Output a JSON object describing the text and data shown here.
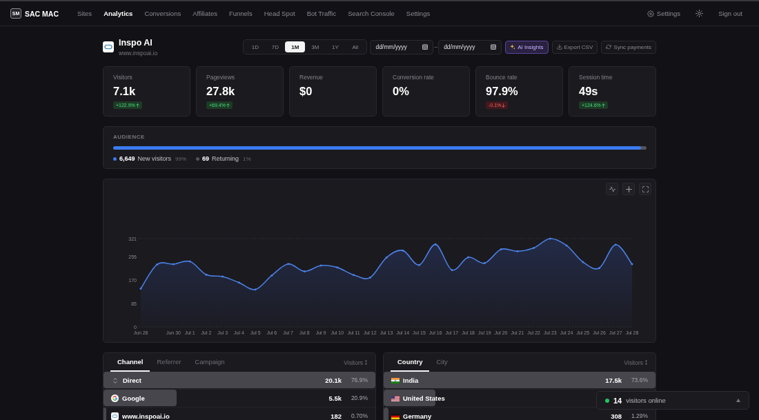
{
  "nav": {
    "logo": {
      "mark": "SM",
      "name": "SAC MAC"
    },
    "items": [
      {
        "label": "Sites",
        "selected": false
      },
      {
        "label": "Analytics",
        "selected": true
      },
      {
        "label": "Conversions",
        "selected": false
      },
      {
        "label": "Affiliates",
        "selected": false
      },
      {
        "label": "Funnels",
        "selected": false
      },
      {
        "label": "Head Spot",
        "selected": false
      },
      {
        "label": "Bot Traffic",
        "selected": false
      },
      {
        "label": "Search Console",
        "selected": false
      },
      {
        "label": "Settings",
        "selected": false
      }
    ],
    "settings_label": "Settings",
    "sign_out": "Sign out"
  },
  "site": {
    "name": "Inspo AI",
    "url": "www.inspoai.io"
  },
  "ranges": [
    {
      "label": "1D",
      "selected": false
    },
    {
      "label": "7D",
      "selected": false
    },
    {
      "label": "1M",
      "selected": true
    },
    {
      "label": "3M",
      "selected": false
    },
    {
      "label": "1Y",
      "selected": false
    },
    {
      "label": "All",
      "selected": false
    }
  ],
  "date_from": {
    "placeholder": "dd/mm/yyyy"
  },
  "date_separator": "–",
  "date_to": {
    "placeholder": "dd/mm/yyyy"
  },
  "actions": [
    {
      "kind": "ai",
      "label": "AI Insights"
    },
    {
      "kind": "export",
      "label": "Export CSV"
    },
    {
      "kind": "sync",
      "label": "Sync payments"
    }
  ],
  "stats": [
    {
      "label": "Visitors",
      "value": "7.1k",
      "delta": "+122.9%",
      "rising": true
    },
    {
      "label": "Pageviews",
      "value": "27.8k",
      "delta": "+69.4%",
      "rising": true
    },
    {
      "label": "Revenue",
      "value": "$0"
    },
    {
      "label": "Conversion rate",
      "value": "0%"
    },
    {
      "label": "Bounce rate",
      "value": "97.9%",
      "delta": "-0.1%",
      "rising": false
    },
    {
      "label": "Session time",
      "value": "49s",
      "delta": "+124.6%",
      "rising": true
    }
  ],
  "audience": {
    "title": "AUDIENCE",
    "level": 0.99,
    "segments": [
      {
        "count": "6,649",
        "label": "New visitors",
        "share": "99%",
        "color": "#3b7bf0"
      },
      {
        "count": "69",
        "label": "Returning",
        "share": "1%",
        "color": "#55545a"
      }
    ]
  },
  "chart": {
    "tools": [
      {
        "kind": "activity"
      },
      {
        "kind": "zoom"
      },
      {
        "kind": "fullscreen"
      }
    ],
    "chart_data": {
      "type": "area",
      "categories": [
        "Jun 28",
        null,
        "Jun 30",
        "Jul 1",
        "Jul 2",
        "Jul 3",
        "Jul 4",
        "Jul 5",
        "Jul 6",
        "Jul 7",
        "Jul 8",
        "Jul 9",
        "Jul 10",
        "Jul 11",
        "Jul 12",
        "Jul 13",
        "Jul 14",
        "Jul 15",
        "Jul 16",
        "Jul 17",
        "Jul 18",
        "Jul 19",
        "Jul 20",
        "Jul 21",
        "Jul 22",
        "Jul 23",
        "Jul 24",
        "Jul 25",
        "Jul 26",
        "Jul 27",
        "Jul 28"
      ],
      "values": [
        139,
        227,
        228,
        238,
        190,
        183,
        161,
        136,
        187,
        229,
        202,
        223,
        216,
        189,
        179,
        252,
        278,
        225,
        300,
        207,
        253,
        232,
        282,
        275,
        287,
        321,
        296,
        236,
        214,
        299,
        228
      ],
      "ylim": [
        0,
        321
      ],
      "yticks": [
        0,
        85,
        170,
        255,
        321
      ]
    }
  },
  "sources": {
    "tabs": [
      {
        "label": "Channel",
        "selected": true
      },
      {
        "label": "Referrer",
        "selected": false
      },
      {
        "label": "Campaign",
        "selected": false
      }
    ],
    "sort_label": "Visitors",
    "rows": [
      {
        "kind": "direct",
        "name": "Direct",
        "visitors": "20.1k",
        "share": "76.9%",
        "level": 1.0
      },
      {
        "kind": "google",
        "name": "Google",
        "visitors": "5.5k",
        "share": "20.9%",
        "level": 0.27
      },
      {
        "kind": "site",
        "name": "www.inspoai.io",
        "visitors": "182",
        "share": "0.70%",
        "level": 0.009
      }
    ]
  },
  "countries": {
    "tabs": [
      {
        "label": "Country",
        "selected": true
      },
      {
        "label": "City",
        "selected": false
      }
    ],
    "sort_label": "Visitors",
    "rows": [
      {
        "kind": "in",
        "name": "India",
        "visitors": "17.5k",
        "share": "73.6%",
        "level": 1.0
      },
      {
        "kind": "us",
        "name": "United States",
        "level": 0.19
      },
      {
        "kind": "de",
        "name": "Germany",
        "visitors": "308",
        "share": "1.29%",
        "level": 0.0176
      }
    ]
  },
  "online": {
    "count": "14",
    "label": "visitors online"
  }
}
